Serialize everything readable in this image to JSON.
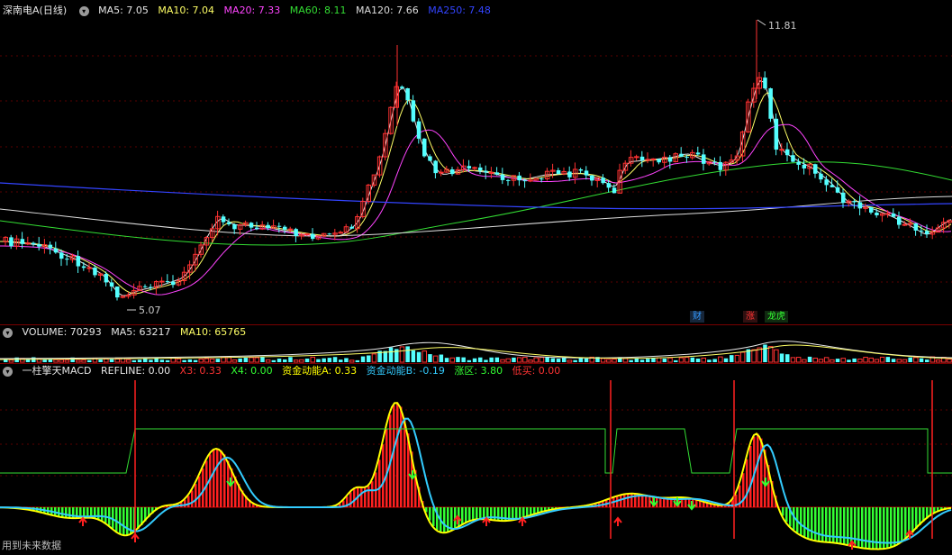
{
  "main": {
    "stock": "深南电A(日线)",
    "ma_items": [
      {
        "label": "MA5: 7.05",
        "color": "#e6e6e6"
      },
      {
        "label": "MA10: 7.04",
        "color": "#ffff66"
      },
      {
        "label": "MA20: 7.33",
        "color": "#ff44ff"
      },
      {
        "label": "MA60: 8.11",
        "color": "#33dd33"
      },
      {
        "label": "MA120: 7.66",
        "color": "#dddddd"
      },
      {
        "label": "MA250: 7.48",
        "color": "#3344ff"
      }
    ],
    "high_label": "11.81",
    "low_label": "5.07",
    "tags": [
      {
        "text": "财",
        "color": "#3399ff"
      },
      {
        "text": "涨",
        "color": "#ff3333"
      },
      {
        "text": "龙虎",
        "color": "#33ff33"
      }
    ]
  },
  "volume": {
    "items": [
      {
        "label": "VOLUME: 70293",
        "color": "#e6e6e6"
      },
      {
        "label": "MA5: 63217",
        "color": "#e6e6e6"
      },
      {
        "label": "MA10: 65765",
        "color": "#ffff66"
      }
    ]
  },
  "indicator": {
    "items": [
      {
        "label": "一柱擎天MACD",
        "color": "#e6e6e6"
      },
      {
        "label": "REFLINE: 0.00",
        "color": "#e6e6e6"
      },
      {
        "label": "X3: 0.33",
        "color": "#ff3333"
      },
      {
        "label": "X4: 0.00",
        "color": "#33ff33"
      },
      {
        "label": "资金动能A: 0.33",
        "color": "#ffff00"
      },
      {
        "label": "资金动能B: -0.19",
        "color": "#33ccff"
      },
      {
        "label": "涨区: 3.80",
        "color": "#33ff33"
      },
      {
        "label": "低买: 0.00",
        "color": "#ff3333"
      }
    ]
  },
  "footer_text": "用到未来数据",
  "colors": {
    "up": "#ff3232",
    "down": "#54ffff",
    "sep": "#7a0000"
  }
}
